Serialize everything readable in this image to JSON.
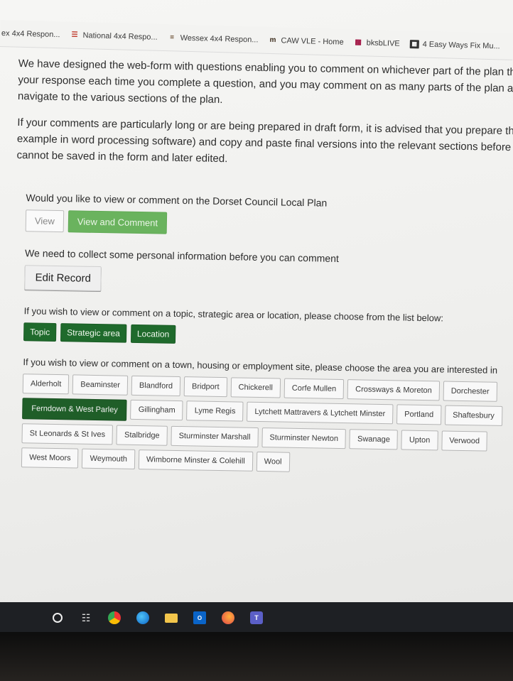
{
  "bookmarks": [
    {
      "label": "ex 4x4 Respon...",
      "icon": "bookmark-icon"
    },
    {
      "label": "National 4x4 Respo...",
      "icon": "stack-icon"
    },
    {
      "label": "Wessex 4x4 Respon...",
      "icon": "bars-icon"
    },
    {
      "label": "CAW VLE - Home",
      "icon": "m-logo-icon"
    },
    {
      "label": "bksbLIVE",
      "icon": "grid-icon"
    },
    {
      "label": "4 Easy Ways Fix Mu...",
      "icon": "doc-icon"
    }
  ],
  "intro": {
    "p1": [
      "We have designed the web-form with questions enabling you to comment on whichever part of the plan that",
      "your response each time you complete a question, and you may comment on as many parts of the plan as y",
      "navigate to the various sections of the plan."
    ],
    "p2": [
      "If your comments are particularly long or are being prepared in draft form, it is advised that you prepare them",
      "example in word processing software) and copy and paste final versions into the relevant sections before subm",
      "cannot be saved in the form and later edited."
    ]
  },
  "view_section": {
    "question": "Would you like to view or comment on the Dorset Council Local Plan",
    "view_label": "View",
    "view_comment_label": "View and Comment"
  },
  "personal_section": {
    "text": "We need to collect some personal information before you can comment",
    "edit_label": "Edit Record"
  },
  "topic_section": {
    "text": "If you wish to view or comment on a topic, strategic area or location, please choose from the list below:",
    "buttons": [
      "Topic",
      "Strategic area",
      "Location"
    ]
  },
  "area_section": {
    "text": "If you wish to view or comment on a town, housing or employment site, please choose the area you are interested in",
    "selected": "Ferndown & West Parley",
    "rows": [
      [
        "Alderholt",
        "Beaminster",
        "Blandford",
        "Bridport",
        "Chickerell",
        "Corfe Mullen",
        "Crossways & Moreton",
        "Dorchester"
      ],
      [
        "Ferndown & West Parley",
        "Gillingham",
        "Lyme Regis",
        "Lytchett Mattravers & Lytchett Minster",
        "Portland",
        "Shaftesbury"
      ],
      [
        "St Leonards & St Ives",
        "Stalbridge",
        "Sturminster Marshall",
        "Sturminster Newton",
        "Swanage",
        "Upton",
        "Verwood"
      ],
      [
        "West Moors",
        "Weymouth",
        "Wimborne Minster & Colehill",
        "Wool"
      ]
    ]
  },
  "colors": {
    "view_comment_green": "#6ab35e",
    "dark_green": "#1f6a2c",
    "selected_green": "#1f5e28"
  }
}
